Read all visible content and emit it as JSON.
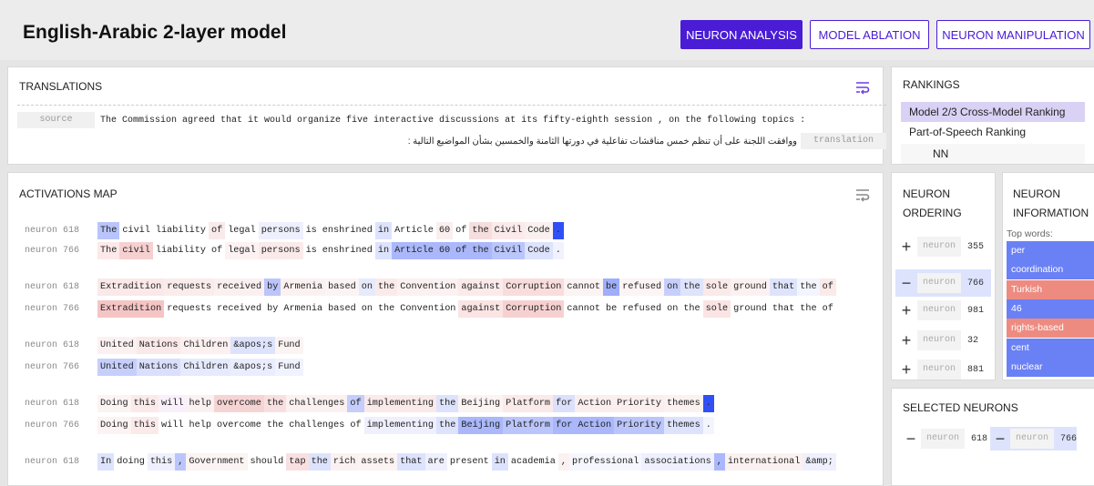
{
  "header": {
    "title": "English-Arabic 2-layer model",
    "nav": [
      "NEURON ANALYSIS",
      "MODEL ABLATION",
      "NEURON MANIPULATION"
    ]
  },
  "translations": {
    "title": "TRANSLATIONS",
    "source_tag": "source",
    "source_text": "The Commission agreed that it would organize five interactive discussions at its fifty-eighth session , on the following topics :",
    "translation_tag": "translation",
    "translation_text": "ووافقت اللجنة على أن تنظم خمس مناقشات تفاعلية في دورتها الثامنة والخمسين بشأن المواضيع التالية :"
  },
  "rankings": {
    "title": "RANKINGS",
    "items": [
      "Model 2/3 Cross-Model Ranking",
      "Part-of-Speech Ranking"
    ],
    "sub_item": "NN"
  },
  "activations": {
    "title": "ACTIVATIONS MAP",
    "rows": [
      {
        "label": "neuron 618",
        "tokens": [
          [
            "The",
            "#b9c4fa"
          ],
          [
            "civil",
            ""
          ],
          [
            "liability",
            ""
          ],
          [
            "of",
            "#f9eaeb"
          ],
          [
            "legal",
            ""
          ],
          [
            "persons",
            "#eef0fe"
          ],
          [
            "is",
            ""
          ],
          [
            "enshrined",
            ""
          ],
          [
            "in",
            "#dde3fd"
          ],
          [
            "Article",
            ""
          ],
          [
            "60",
            "#fbeeee"
          ],
          [
            "of",
            ""
          ],
          [
            "the",
            "#f7dede"
          ],
          [
            "Civil",
            "#fbeaea"
          ],
          [
            "Code",
            "#fbf0f0"
          ],
          [
            ".",
            "#3050f5"
          ]
        ]
      },
      {
        "label": "neuron 766",
        "tokens": [
          [
            "The",
            "#fde9e9"
          ],
          [
            "civil",
            "#f6d0d0"
          ],
          [
            "liability",
            ""
          ],
          [
            "of",
            ""
          ],
          [
            "legal",
            "#fdf2f2"
          ],
          [
            "persons",
            "#fbeaea"
          ],
          [
            "is",
            ""
          ],
          [
            "enshrined",
            ""
          ],
          [
            "in",
            "#dde3fd"
          ],
          [
            "Article",
            "#aab8fb"
          ],
          [
            "60",
            "#aab8fb"
          ],
          [
            "of",
            "#aab8fb"
          ],
          [
            "the",
            "#aab8fb"
          ],
          [
            "Civil",
            "#bac6fb"
          ],
          [
            "Code",
            "#dde3fd"
          ],
          [
            ".",
            "#f0f2fe"
          ]
        ]
      },
      {
        "label": "neuron 618",
        "tokens": [
          [
            "Extradition",
            "#fbe8e8"
          ],
          [
            "requests",
            "#fbecec"
          ],
          [
            "received",
            "#fbf0f0"
          ],
          [
            "by",
            "#bbc5fb"
          ],
          [
            "Armenia",
            "#fcf1f1"
          ],
          [
            "based",
            "#fcf3f3"
          ],
          [
            "on",
            "#e6eafd"
          ],
          [
            "the",
            "#fbeaea"
          ],
          [
            "Convention",
            "#fcf1f1"
          ],
          [
            "against",
            "#fbeaea"
          ],
          [
            "Corruption",
            "#f9dddd"
          ],
          [
            "cannot",
            "#fcf3f3"
          ],
          [
            "be",
            "#9eaefa"
          ],
          [
            "refused",
            "#fdf4f4"
          ],
          [
            "on",
            "#c6cffc"
          ],
          [
            "the",
            "#dfe4fd"
          ],
          [
            "sole",
            "#fbeaea"
          ],
          [
            "ground",
            "#fcf1f1"
          ],
          [
            "that",
            "#dfe4fd"
          ],
          [
            "the",
            "#f3f5fe"
          ],
          [
            "of",
            "#fbeaea"
          ]
        ]
      },
      {
        "label": "neuron 766",
        "tokens": [
          [
            "Extradition",
            "#f5c5c5"
          ],
          [
            "requests",
            ""
          ],
          [
            "received",
            ""
          ],
          [
            "by",
            ""
          ],
          [
            "Armenia",
            ""
          ],
          [
            "based",
            ""
          ],
          [
            "on",
            ""
          ],
          [
            "the",
            ""
          ],
          [
            "Convention",
            ""
          ],
          [
            "against",
            "#fbe4e4"
          ],
          [
            "Corruption",
            "#f7d1d1"
          ],
          [
            "cannot",
            ""
          ],
          [
            "be",
            ""
          ],
          [
            "refused",
            ""
          ],
          [
            "on",
            ""
          ],
          [
            "the",
            ""
          ],
          [
            "sole",
            "#fbe4e4"
          ],
          [
            "ground",
            ""
          ],
          [
            "that",
            ""
          ],
          [
            "the",
            ""
          ],
          [
            "of",
            ""
          ]
        ]
      },
      {
        "label": "neuron 618",
        "tokens": [
          [
            "United",
            "#fcf1f1"
          ],
          [
            "Nations",
            "#fbe9e9"
          ],
          [
            "Children",
            "#fcf0f0"
          ],
          [
            "&apos;s",
            "#dee3fd"
          ],
          [
            "Fund",
            "#fcf3f3"
          ]
        ]
      },
      {
        "label": "neuron 766",
        "tokens": [
          [
            "United",
            "#c6cffc"
          ],
          [
            "Nations",
            "#d9dffd"
          ],
          [
            "Children",
            "#e6eafd"
          ],
          [
            "&apos;s",
            "#eaedfe"
          ],
          [
            "Fund",
            "#f0f2fe"
          ]
        ]
      },
      {
        "label": "neuron 618",
        "tokens": [
          [
            "Doing",
            "#fcf3f3"
          ],
          [
            "this",
            "#fbeaea"
          ],
          [
            "will",
            "#f9f0fb"
          ],
          [
            "help",
            "#fcf1f1"
          ],
          [
            "overcome",
            "#f7d4d4"
          ],
          [
            "the",
            "#f9e0e0"
          ],
          [
            "challenges",
            "#fcf1f1"
          ],
          [
            "of",
            "#c4cdfc"
          ],
          [
            "implementing",
            "#fbeaea"
          ],
          [
            "the",
            "#dde3fd"
          ],
          [
            "Beijing",
            "#fcf3f3"
          ],
          [
            "Platform",
            "#fbeaea"
          ],
          [
            "for",
            "#dbe1fd"
          ],
          [
            "Action",
            "#fbeeee"
          ],
          [
            "Priority",
            "#fbeeee"
          ],
          [
            "themes",
            "#fcf1f1"
          ],
          [
            ".",
            "#3050f5"
          ]
        ]
      },
      {
        "label": "neuron 766",
        "tokens": [
          [
            "Doing",
            "#fcf3f3"
          ],
          [
            "this",
            "#fbeaea"
          ],
          [
            "will",
            ""
          ],
          [
            "help",
            ""
          ],
          [
            "overcome",
            ""
          ],
          [
            "the",
            ""
          ],
          [
            "challenges",
            ""
          ],
          [
            "of",
            ""
          ],
          [
            "implementing",
            "#eef0fe"
          ],
          [
            "the",
            "#dde3fd"
          ],
          [
            "Beijing",
            "#aab8fb"
          ],
          [
            "Platform",
            "#bac6fb"
          ],
          [
            "for",
            "#aab8fb"
          ],
          [
            "Action",
            "#aab8fb"
          ],
          [
            "Priority",
            "#bac6fb"
          ],
          [
            "themes",
            "#dde3fd"
          ],
          [
            ".",
            "#f3f5fe"
          ]
        ]
      },
      {
        "label": "neuron 618",
        "tokens": [
          [
            "In",
            "#dde3fd"
          ],
          [
            "doing",
            ""
          ],
          [
            "this",
            "#eef0fe"
          ],
          [
            ",",
            "#bac6fb"
          ],
          [
            "Government",
            "#fcf3f3"
          ],
          [
            "should",
            ""
          ],
          [
            "tap",
            "#f9e0e0"
          ],
          [
            "the",
            "#dde3fd"
          ],
          [
            "rich",
            "#fcf1f1"
          ],
          [
            "assets",
            "#fcf3f3"
          ],
          [
            "that",
            "#dde3fd"
          ],
          [
            "are",
            "#eef0fe"
          ],
          [
            "present",
            ""
          ],
          [
            "in",
            "#dde3fd"
          ],
          [
            "academia",
            ""
          ],
          [
            ",",
            "#fcf1f1"
          ],
          [
            "professional",
            "#f6f7fe"
          ],
          [
            "associations",
            "#eef0fe"
          ],
          [
            ",",
            "#aab8fb"
          ],
          [
            "international",
            "#fcf1f1"
          ],
          [
            "&amp;",
            "#eef0fe"
          ]
        ]
      }
    ]
  },
  "ordering": {
    "title_line1": "NEURON",
    "title_line2": "ORDERING",
    "items": [
      {
        "sign": "+",
        "label": "neuron",
        "id": "355"
      },
      {
        "sign": "−",
        "label": "neuron",
        "id": "766"
      },
      {
        "sign": "+",
        "label": "neuron",
        "id": "981"
      },
      {
        "sign": "+",
        "label": "neuron",
        "id": "32"
      },
      {
        "sign": "+",
        "label": "neuron",
        "id": "881"
      }
    ]
  },
  "information": {
    "title_line1": "NEURON",
    "title_line2": "INFORMATION",
    "top_words_label": "Top words:",
    "top_words": [
      {
        "word": "per",
        "color": "#6a80f5"
      },
      {
        "word": "coordination",
        "color": "#6a80f5"
      },
      {
        "word": "Turkish",
        "color": "#ee8b80"
      },
      {
        "word": "46",
        "color": "#6a80f5"
      },
      {
        "word": "rights-based",
        "color": "#ee8b80"
      },
      {
        "word": "cent",
        "color": "#6a80f5"
      },
      {
        "word": "nuclear",
        "color": "#6a80f5"
      }
    ]
  },
  "selected": {
    "title": "SELECTED NEURONS",
    "items": [
      {
        "sign": "−",
        "label": "neuron",
        "id": "618"
      },
      {
        "sign": "−",
        "label": "neuron",
        "id": "766"
      }
    ]
  },
  "colors": {
    "accent": "#4a1cd6",
    "rank_selected": "#d9d2f5"
  }
}
